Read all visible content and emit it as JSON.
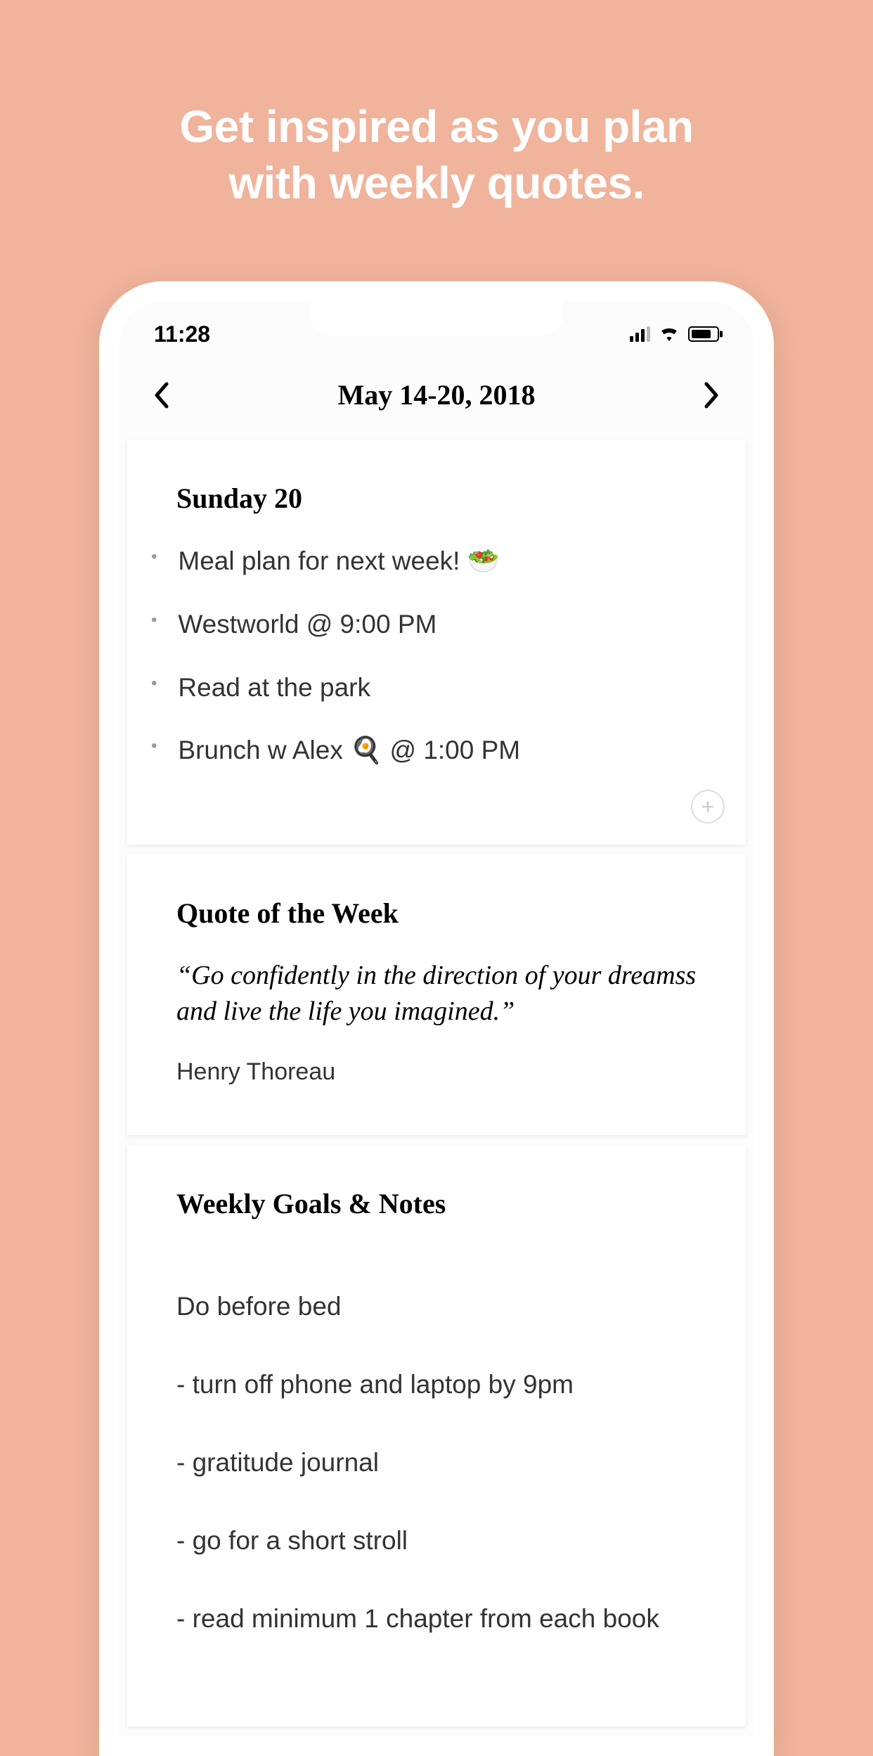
{
  "promo": {
    "line1": "Get inspired as you plan",
    "line2": "with weekly quotes."
  },
  "status": {
    "time": "11:28"
  },
  "nav": {
    "title": "May 14-20, 2018"
  },
  "day": {
    "title": "Sunday 20",
    "tasks": [
      "Meal plan for next week! 🥗",
      "Westworld  @ 9:00 PM",
      "Read at the park",
      "Brunch w Alex 🍳 @ 1:00 PM"
    ]
  },
  "quote": {
    "title": "Quote of the Week",
    "text": "“Go confidently in the direction of your dreamss and live the life you imagined.”",
    "author": "Henry Thoreau"
  },
  "goals": {
    "title": "Weekly Goals & Notes",
    "intro": "Do before bed",
    "items": [
      "- turn off phone and laptop by 9pm",
      "- gratitude journal",
      "- go for a short stroll",
      "- read minimum 1 chapter from each book"
    ]
  }
}
